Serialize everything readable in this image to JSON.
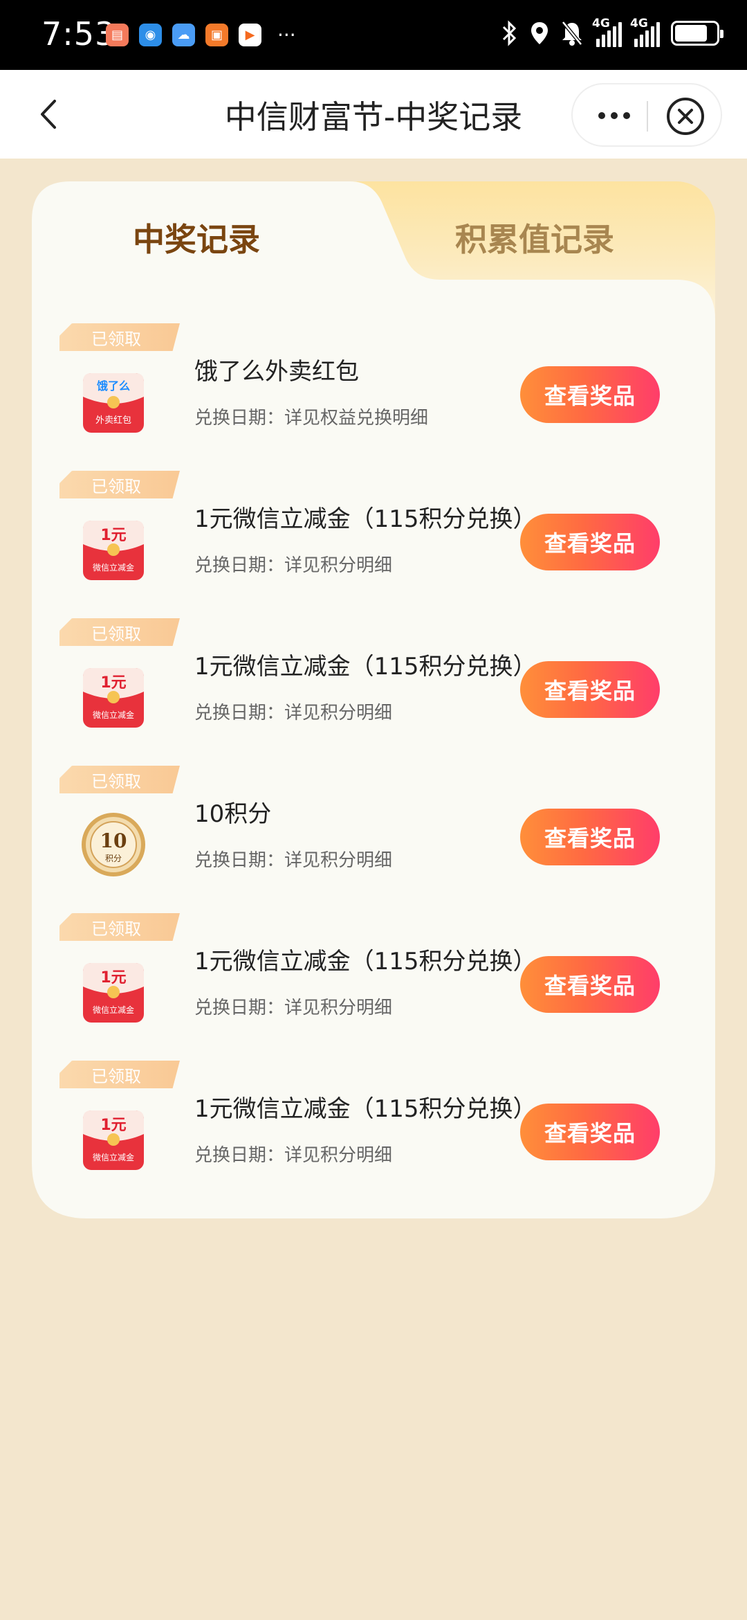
{
  "status_bar": {
    "time": "7:53",
    "network_1": "4G",
    "network_2": "4G",
    "more": "···"
  },
  "header": {
    "title": "中信财富节-中奖记录"
  },
  "tabs": {
    "active": "中奖记录",
    "other": "积累值记录"
  },
  "records": [
    {
      "tag": "已领取",
      "title": "饿了么外卖红包",
      "subtitle": "兑换日期：详见权益兑换明细",
      "button": "查看奖品",
      "icon": "eleme-red-packet-icon",
      "icon_top": "饿了么",
      "icon_bottom": "外卖红包"
    },
    {
      "tag": "已领取",
      "title": "1元微信立减金（115积分兑换）",
      "subtitle": "兑换日期：详见积分明细",
      "button": "查看奖品",
      "icon": "wechat-discount-packet-icon",
      "icon_top": "1元",
      "icon_bottom": "微信立减金"
    },
    {
      "tag": "已领取",
      "title": "1元微信立减金（115积分兑换）",
      "subtitle": "兑换日期：详见积分明细",
      "button": "查看奖品",
      "icon": "wechat-discount-packet-icon",
      "icon_top": "1元",
      "icon_bottom": "微信立减金"
    },
    {
      "tag": "已领取",
      "title": "10积分",
      "subtitle": "兑换日期：详见积分明细",
      "button": "查看奖品",
      "icon": "points-coin-icon",
      "icon_top": "10",
      "icon_bottom": "积分"
    },
    {
      "tag": "已领取",
      "title": "1元微信立减金（115积分兑换）",
      "subtitle": "兑换日期：详见积分明细",
      "button": "查看奖品",
      "icon": "wechat-discount-packet-icon",
      "icon_top": "1元",
      "icon_bottom": "微信立减金"
    },
    {
      "tag": "已领取",
      "title": "1元微信立减金（115积分兑换）",
      "subtitle": "兑换日期：详见积分明细",
      "button": "查看奖品",
      "icon": "wechat-discount-packet-icon",
      "icon_top": "1元",
      "icon_bottom": "微信立减金"
    }
  ],
  "colors": {
    "page_bg": "#f3e6cd",
    "card_bg": "#fafaf4",
    "active_tab": "#7a4510",
    "inactive_tab": "#a88650",
    "button_start": "#ff8f3a",
    "button_end": "#ff3d6a"
  }
}
